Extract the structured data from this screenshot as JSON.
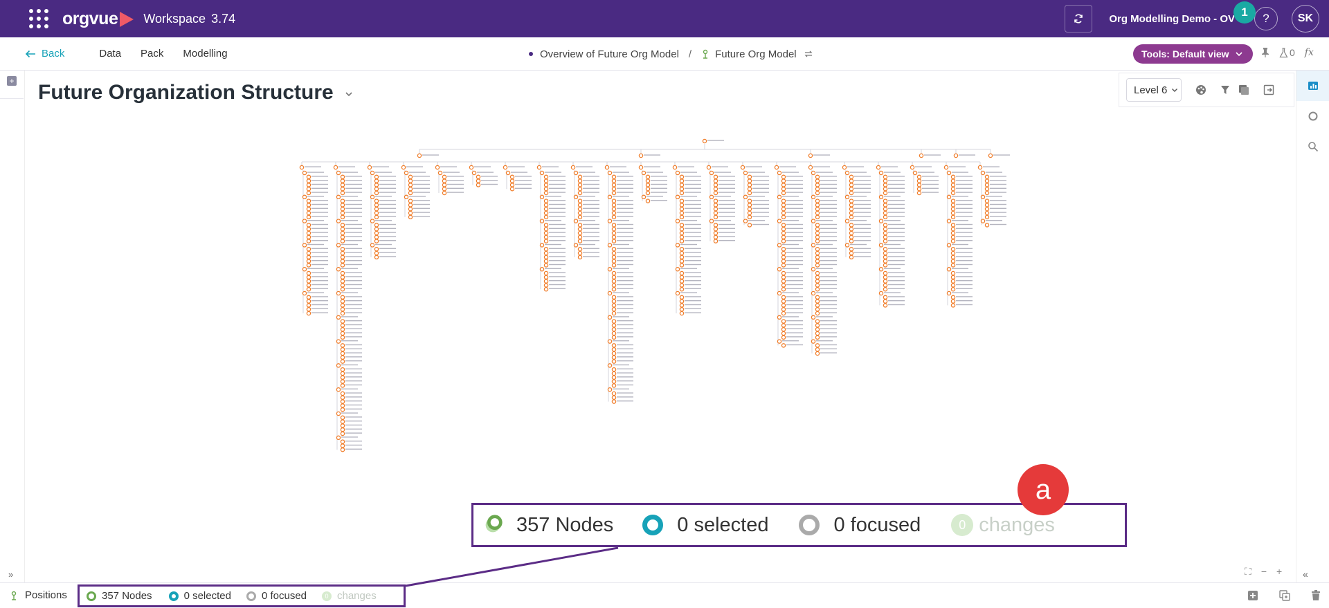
{
  "topbar": {
    "app_name": "orgvue",
    "workspace_label": "Workspace",
    "version": "3.74",
    "dataset": "Org Modelling Demo - OV",
    "notification_count": "1",
    "help_label": "?",
    "user_initials": "SK"
  },
  "nav": {
    "back_label": "Back",
    "links": [
      "Data",
      "Pack",
      "Modelling"
    ],
    "breadcrumb_page": "Overview of Future Org Model",
    "breadcrumb_separator": "/",
    "breadcrumb_model": "Future Org Model",
    "tools_label": "Tools: Default view",
    "flask_count": "0",
    "fx_label": "fx"
  },
  "view": {
    "title": "Future Organization Structure",
    "level_label": "Level 6"
  },
  "chart_data": {
    "type": "org-tree",
    "root": "Chief Executive Officer",
    "level_1": [
      "Chief Technology Officer",
      "Chief Business Officer",
      "President - Client Success",
      "Head of Legal & Risk",
      "Chief Financial Officer",
      "Chief Human Resources Officer"
    ],
    "columns": [
      {
        "head": "Chief Product Officer",
        "n": 36
      },
      {
        "head": "VP - Engineering",
        "n": 70
      },
      {
        "head": "Head of QA",
        "n": 22
      },
      {
        "head": "Head of Client Support",
        "n": 12
      },
      {
        "head": "Head of Service Interface",
        "n": 6
      },
      {
        "head": "Head of Decision Architecture",
        "n": 4
      },
      {
        "head": "Head Application Architecture",
        "n": 5
      },
      {
        "head": "Head of DevOps",
        "n": 30
      },
      {
        "head": "Enablement Sales Ops",
        "n": 22
      },
      {
        "head": "Head of Demand Generation",
        "n": 58
      },
      {
        "head": "VP - Sales - EMEA",
        "n": 8
      },
      {
        "head": "VP - Sales - NA",
        "n": 36
      },
      {
        "head": "VP - Pre-Sales",
        "n": 18
      },
      {
        "head": "Client Success - EMEA",
        "n": 14
      },
      {
        "head": "VP Implementation",
        "n": 44
      },
      {
        "head": "VP - Advisory",
        "n": 46
      },
      {
        "head": "VP - Client Success - EMEA",
        "n": 22
      },
      {
        "head": "VP - Client Success - NA",
        "n": 34
      },
      {
        "head": "Head of Legal & Risk",
        "n": 6
      },
      {
        "head": "Chief Financial Officer",
        "n": 34
      },
      {
        "head": "Chief Human Resources Officer",
        "n": 14
      }
    ]
  },
  "status": {
    "positions_label": "Positions",
    "nodes": "357 Nodes",
    "selected": "0 selected",
    "focused": "0 focused",
    "changes_count": "0",
    "changes": "changes"
  },
  "callout": {
    "marker_label": "a",
    "nodes": "357 Nodes",
    "selected": "0 selected",
    "focused": "0 focused",
    "changes_count": "0",
    "changes": "changes"
  },
  "colors": {
    "topbar": "#4a2a82",
    "accent_teal": "#1aa9a3",
    "tools_pill": "#8d3a90",
    "node_orange": "#f07d2a",
    "highlight_border": "#5b2c86",
    "marker_red": "#e53a3a"
  }
}
